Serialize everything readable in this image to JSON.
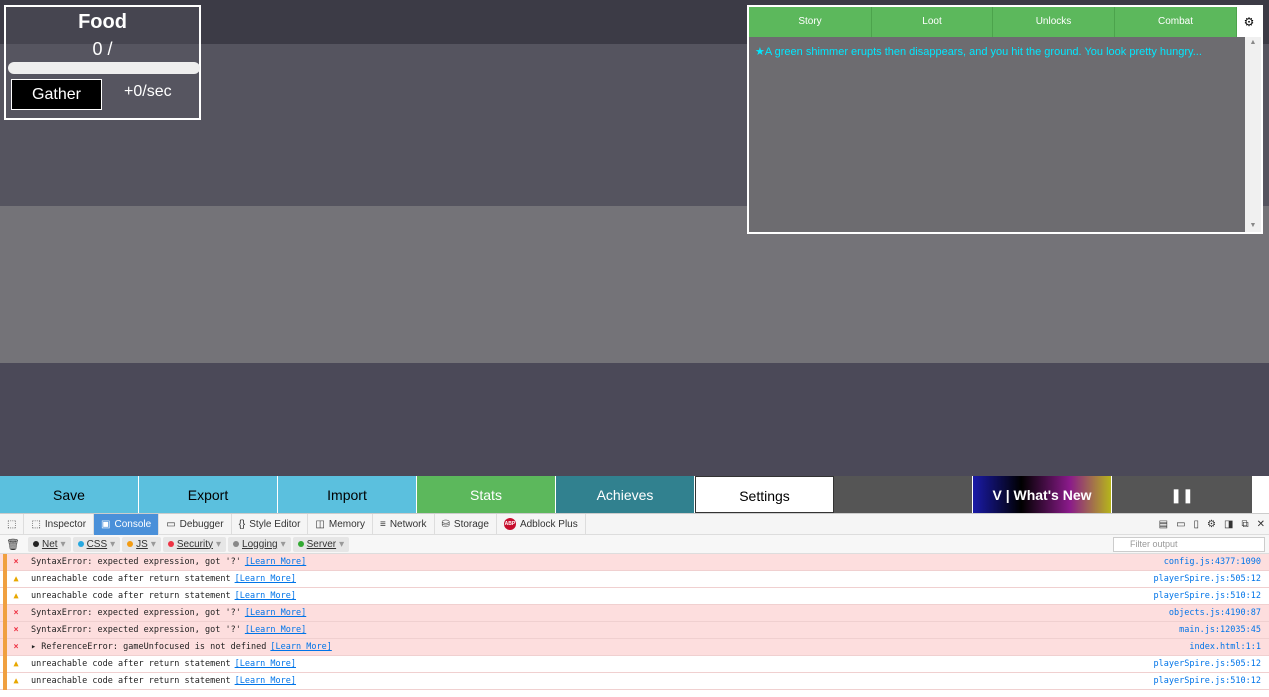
{
  "food": {
    "title": "Food",
    "count": "0 /",
    "progress": 0.0,
    "gather_label": "Gather",
    "rate": "+0/sec"
  },
  "log": {
    "tabs": [
      "Story",
      "Loot",
      "Unlocks",
      "Combat"
    ],
    "gear_icon": "gear-icon",
    "message": "★A green shimmer erupts then disappears, and you hit the ground. You look pretty hungry..."
  },
  "bottom": {
    "save": "Save",
    "export": "Export",
    "import": "Import",
    "stats": "Stats",
    "achieves": "Achieves",
    "settings": "Settings",
    "whatsnew": "V | What's New",
    "pause": "❚❚"
  },
  "devtools": {
    "tabs": [
      {
        "icon": "⬚",
        "label": "Inspector"
      },
      {
        "icon": "▣",
        "label": "Console"
      },
      {
        "icon": "▭",
        "label": "Debugger"
      },
      {
        "icon": "{}",
        "label": "Style Editor"
      },
      {
        "icon": "◫",
        "label": "Memory"
      },
      {
        "icon": "≡",
        "label": "Network"
      },
      {
        "icon": "⛁",
        "label": "Storage"
      },
      {
        "icon": "ABP",
        "label": "Adblock Plus"
      }
    ],
    "filters": [
      {
        "label": "Net",
        "color": "#222"
      },
      {
        "label": "CSS",
        "color": "#25a8e0"
      },
      {
        "label": "JS",
        "color": "#f39c12"
      },
      {
        "label": "Security",
        "color": "#e34"
      },
      {
        "label": "Logging",
        "color": "#888"
      },
      {
        "label": "Server",
        "color": "#3a3"
      }
    ],
    "filter_placeholder": "Filter output",
    "messages": [
      {
        "type": "error",
        "text": "SyntaxError: expected expression, got '?'",
        "link": "[Learn More]",
        "src": "config.js:4377:1090"
      },
      {
        "type": "warn",
        "text": "unreachable code after return statement",
        "link": "[Learn More]",
        "src": "playerSpire.js:505:12"
      },
      {
        "type": "warn",
        "text": "unreachable code after return statement",
        "link": "[Learn More]",
        "src": "playerSpire.js:510:12"
      },
      {
        "type": "error",
        "text": "SyntaxError: expected expression, got '?'",
        "link": "[Learn More]",
        "src": "objects.js:4190:87"
      },
      {
        "type": "error",
        "text": "SyntaxError: expected expression, got '?'",
        "link": "[Learn More]",
        "src": "main.js:12035:45"
      },
      {
        "type": "error",
        "text": "▸ ReferenceError: gameUnfocused is not defined",
        "link": "[Learn More]",
        "src": "index.html:1:1"
      },
      {
        "type": "warn",
        "text": "unreachable code after return statement",
        "link": "[Learn More]",
        "src": "playerSpire.js:505:12"
      },
      {
        "type": "warn",
        "text": "unreachable code after return statement",
        "link": "[Learn More]",
        "src": "playerSpire.js:510:12"
      }
    ]
  }
}
